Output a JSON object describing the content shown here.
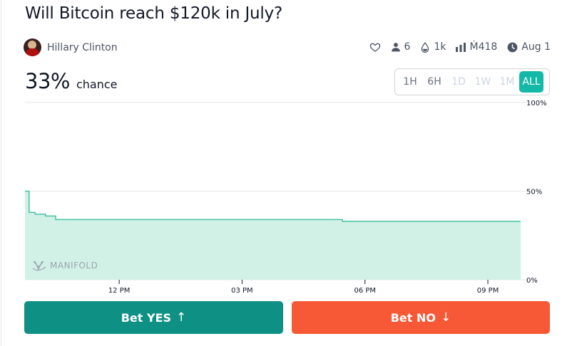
{
  "market": {
    "title": "Will Bitcoin reach $120k in July?"
  },
  "author": {
    "name": "Hillary Clinton"
  },
  "stats": {
    "heart_icon": "heart-icon",
    "traders": "6",
    "liquidity": "1k",
    "volume": "Ṁ418",
    "close_date": "Aug 1"
  },
  "probability": {
    "value": "33%",
    "label": "chance"
  },
  "time_ranges": [
    {
      "label": "1H",
      "state": "enabled"
    },
    {
      "label": "6H",
      "state": "enabled"
    },
    {
      "label": "1D",
      "state": "disabled"
    },
    {
      "label": "1W",
      "state": "disabled"
    },
    {
      "label": "1M",
      "state": "disabled"
    },
    {
      "label": "ALL",
      "state": "active"
    }
  ],
  "watermark": "MANIFOLD",
  "chart_data": {
    "type": "area",
    "xlabel": "",
    "ylabel": "",
    "ylim": [
      0,
      100
    ],
    "y_ticks": [
      "0%",
      "50%",
      "100%"
    ],
    "x_ticks": [
      "12 PM",
      "03 PM",
      "06 PM",
      "09 PM"
    ],
    "x_unit": "hours_since_midnight",
    "xlim": [
      9.7,
      21.8
    ],
    "tick_hours": [
      12,
      15,
      18,
      21
    ],
    "series": [
      {
        "points": [
          [
            9.7,
            50
          ],
          [
            9.8,
            38
          ],
          [
            9.95,
            37
          ],
          [
            10.2,
            36
          ],
          [
            10.45,
            34
          ],
          [
            17.3,
            34
          ],
          [
            17.45,
            33
          ],
          [
            21.8,
            33
          ]
        ]
      }
    ],
    "line_color": "#46c2a0",
    "fill_color": "#d1f1e6"
  },
  "actions": {
    "yes_label": "Bet YES",
    "yes_arrow": "↑",
    "no_label": "Bet NO",
    "no_arrow": "↓"
  }
}
